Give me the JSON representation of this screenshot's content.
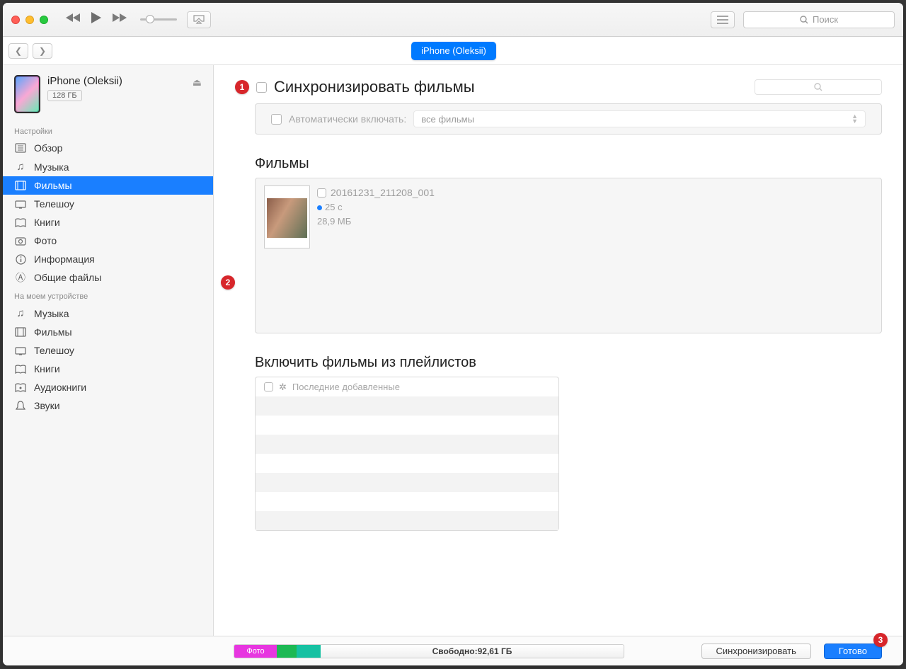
{
  "search_placeholder": "Поиск",
  "tab_label": "iPhone (Oleksii)",
  "device": {
    "name": "iPhone (Oleksii)",
    "capacity": "128 ГБ"
  },
  "sidebar": {
    "settings_header": "Настройки",
    "settings": [
      "Обзор",
      "Музыка",
      "Фильмы",
      "Телешоу",
      "Книги",
      "Фото",
      "Информация",
      "Общие файлы"
    ],
    "ondevice_header": "На моем устройстве",
    "ondevice": [
      "Музыка",
      "Фильмы",
      "Телешоу",
      "Книги",
      "Аудиокниги",
      "Звуки"
    ]
  },
  "main": {
    "sync_title": "Синхронизировать фильмы",
    "auto_include_label": "Автоматически включать:",
    "auto_include_value": "все фильмы",
    "movies_title": "Фильмы",
    "movie": {
      "name": "20161231_211208_001",
      "duration": "25 с",
      "size": "28,9 МБ"
    },
    "playlists_title": "Включить фильмы из плейлистов",
    "playlist_item": "Последние добавленные"
  },
  "footer": {
    "photo_label": "Фото",
    "free_prefix": "Свободно: ",
    "free_value": "92,61 ГБ",
    "sync_btn": "Синхронизировать",
    "done_btn": "Готово"
  },
  "annotations": {
    "n1": "1",
    "n2": "2",
    "n3": "3"
  }
}
